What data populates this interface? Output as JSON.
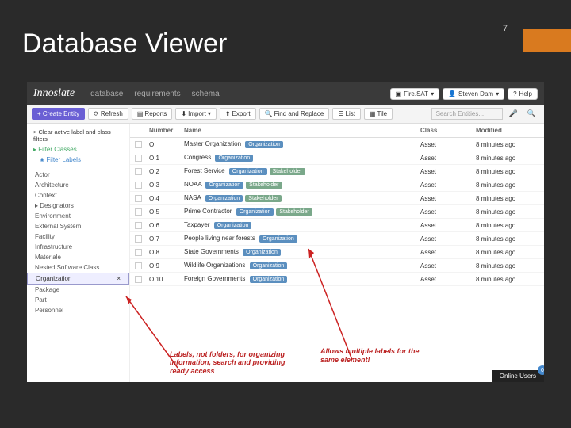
{
  "slide": {
    "title": "Database Viewer",
    "page": "7"
  },
  "topbar": {
    "brand": "Innoslate",
    "nav": [
      "database",
      "requirements",
      "schema"
    ],
    "project_btn": "Fire.SAT",
    "user_btn": "Steven Dam",
    "help_btn": "Help"
  },
  "toolbar": {
    "create": "+ Create Entity",
    "refresh": "Refresh",
    "reports": "Reports",
    "import": "Import",
    "export": "Export",
    "find": "Find and Replace",
    "list": "List",
    "tile": "Tile",
    "search_placeholder": "Search Entities..."
  },
  "sidebar": {
    "clear": "Clear active label and class filters",
    "filter_classes": "Filter Classes",
    "filter_labels": "Filter Labels",
    "classes": [
      "Actor",
      "Architecture",
      "Context",
      "Designators",
      "Environment",
      "External System",
      "Facility",
      "Infrastructure",
      "Materiale",
      "Nested Software Class",
      "Organization",
      "Package",
      "Part",
      "Personnel"
    ]
  },
  "table": {
    "headers": {
      "number": "Number",
      "name": "Name",
      "class": "Class",
      "modified": "Modified"
    },
    "rows": [
      {
        "num": "O",
        "name": "Master Organization",
        "tags": [
          "Organization"
        ],
        "class": "Asset",
        "mod": "8 minutes ago"
      },
      {
        "num": "O.1",
        "name": "Congress",
        "tags": [
          "Organization"
        ],
        "class": "Asset",
        "mod": "8 minutes ago"
      },
      {
        "num": "O.2",
        "name": "Forest Service",
        "tags": [
          "Organization",
          "Stakeholder"
        ],
        "class": "Asset",
        "mod": "8 minutes ago"
      },
      {
        "num": "O.3",
        "name": "NOAA",
        "tags": [
          "Organization",
          "Stakeholder"
        ],
        "class": "Asset",
        "mod": "8 minutes ago"
      },
      {
        "num": "O.4",
        "name": "NASA",
        "tags": [
          "Organization",
          "Stakeholder"
        ],
        "class": "Asset",
        "mod": "8 minutes ago"
      },
      {
        "num": "O.5",
        "name": "Prime Contractor",
        "tags": [
          "Organization",
          "Stakeholder"
        ],
        "class": "Asset",
        "mod": "8 minutes ago"
      },
      {
        "num": "O.6",
        "name": "Taxpayer",
        "tags": [
          "Organization"
        ],
        "class": "Asset",
        "mod": "8 minutes ago"
      },
      {
        "num": "O.7",
        "name": "People living near forests",
        "tags": [
          "Organization"
        ],
        "class": "Asset",
        "mod": "8 minutes ago"
      },
      {
        "num": "O.8",
        "name": "State Governments",
        "tags": [
          "Organization"
        ],
        "class": "Asset",
        "mod": "8 minutes ago"
      },
      {
        "num": "O.9",
        "name": "Wildlife Organizations",
        "tags": [
          "Organization"
        ],
        "class": "Asset",
        "mod": "8 minutes ago"
      },
      {
        "num": "O.10",
        "name": "Foreign Governments",
        "tags": [
          "Organization"
        ],
        "class": "Asset",
        "mod": "8 minutes ago"
      }
    ]
  },
  "footer": {
    "online": "Online Users",
    "count": "0"
  },
  "annotations": {
    "a1": "Labels, not folders, for organizing information, search and providing ready access",
    "a2": "Allows multiple labels for the same element!"
  }
}
